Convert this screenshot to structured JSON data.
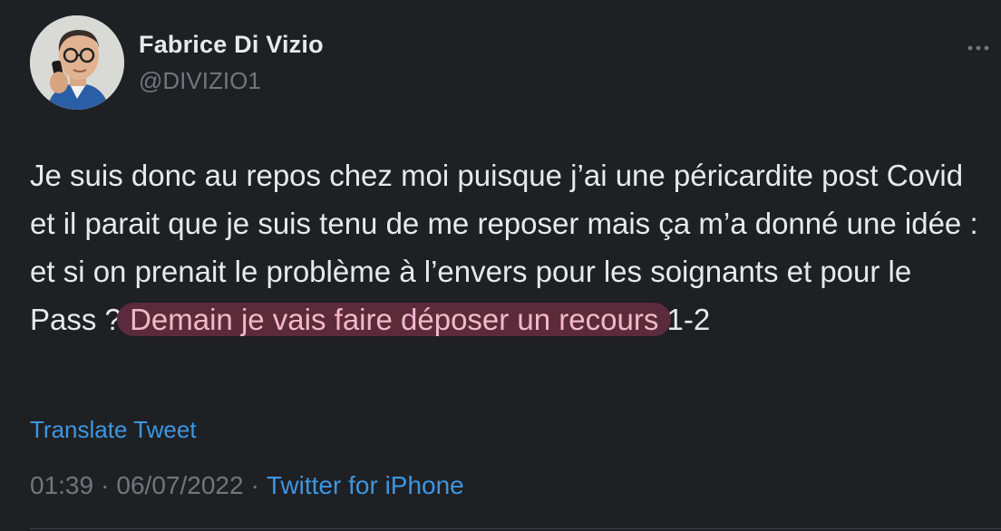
{
  "author": {
    "name": "Fabrice Di Vizio",
    "handle": "@DIVIZIO1"
  },
  "tweet": {
    "text_before_highlight": "Je suis donc au repos chez moi puisque j’ai une péricardite post Covid et il parait que je suis tenu de me reposer mais ça m’a donné une idée : et si on prenait le problème à l’envers pour les soignants et pour le Pass ? ",
    "highlighted_text": "Demain je vais faire déposer un recours",
    "text_after_highlight": " 1-2"
  },
  "translate_label": "Translate Tweet",
  "meta": {
    "time": "01:39",
    "date": "06/07/2022",
    "separator": "·",
    "source": "Twitter for iPhone"
  },
  "icons": {
    "more": "more-dots-icon",
    "avatar": "profile-photo"
  },
  "colors": {
    "background": "#1e2024",
    "link": "#3d96e0",
    "highlight_bg": "#5b2a3b",
    "highlight_text": "#f3b8c8"
  }
}
